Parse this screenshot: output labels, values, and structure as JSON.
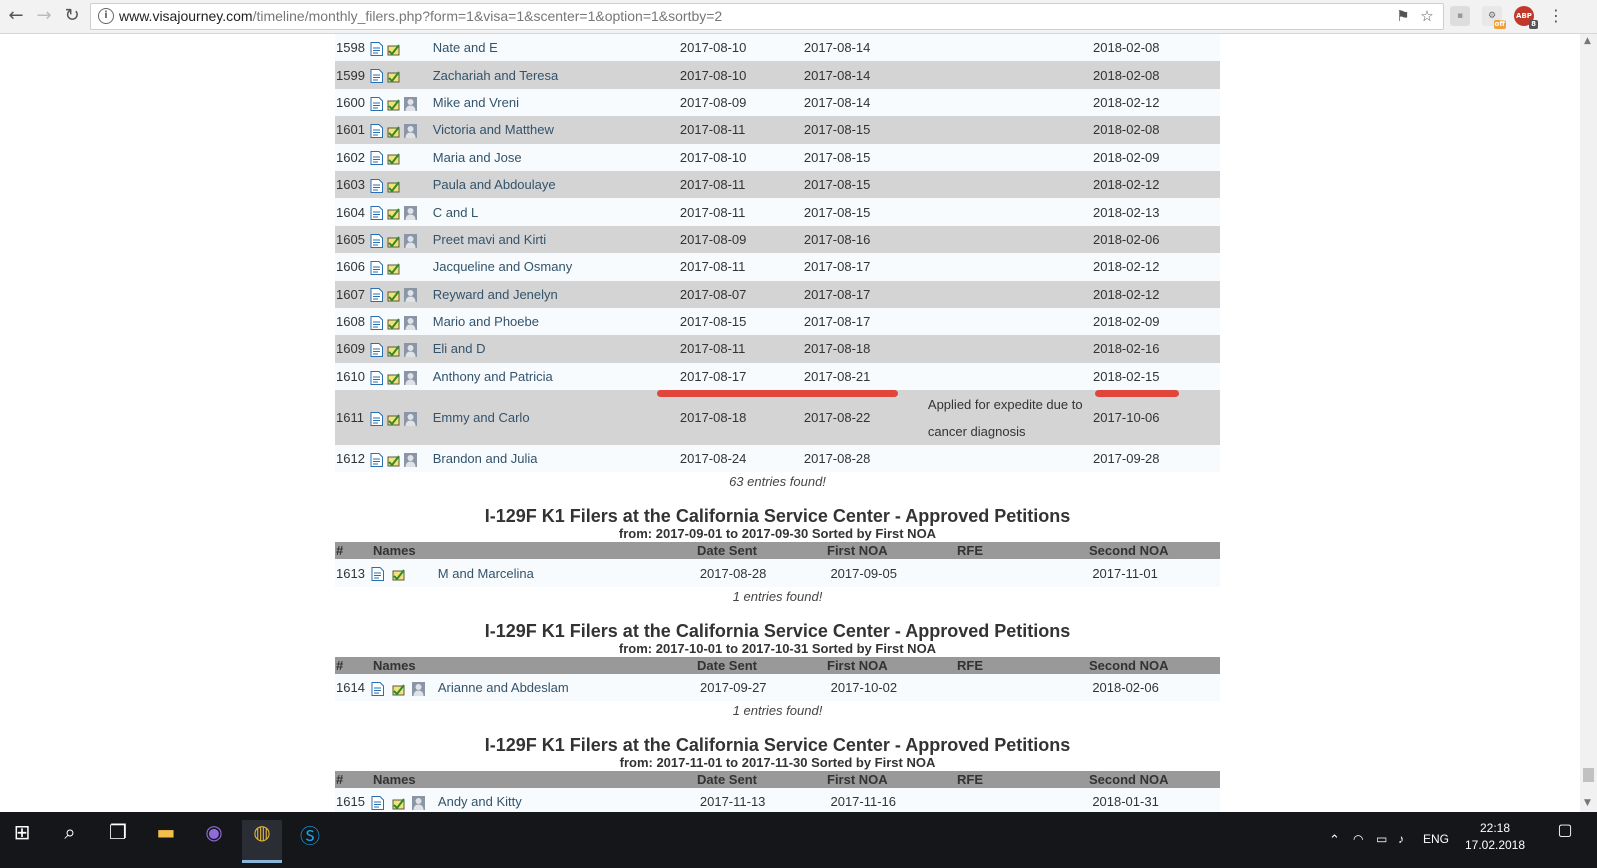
{
  "browser": {
    "url_host": "www.visajourney.com",
    "url_path": "/timeline/monthly_filers.php?form=1&visa=1&scenter=1&option=1&sortby=2",
    "ext_abp_label": "ABP",
    "ext_abp_badge": "8",
    "ext_off_label": "off"
  },
  "section1": {
    "rows": [
      {
        "num": "1598",
        "name": "Nate and E",
        "sent": "2017-08-10",
        "noa1": "2017-08-14",
        "rfe": "",
        "noa2": "2018-02-08",
        "avatar": false
      },
      {
        "num": "1599",
        "name": "Zachariah and Teresa",
        "sent": "2017-08-10",
        "noa1": "2017-08-14",
        "rfe": "",
        "noa2": "2018-02-08",
        "avatar": false
      },
      {
        "num": "1600",
        "name": "Mike and Vreni",
        "sent": "2017-08-09",
        "noa1": "2017-08-14",
        "rfe": "",
        "noa2": "2018-02-12",
        "avatar": true
      },
      {
        "num": "1601",
        "name": "Victoria and Matthew",
        "sent": "2017-08-11",
        "noa1": "2017-08-15",
        "rfe": "",
        "noa2": "2018-02-08",
        "avatar": true
      },
      {
        "num": "1602",
        "name": "Maria and Jose",
        "sent": "2017-08-10",
        "noa1": "2017-08-15",
        "rfe": "",
        "noa2": "2018-02-09",
        "avatar": false
      },
      {
        "num": "1603",
        "name": "Paula and Abdoulaye",
        "sent": "2017-08-11",
        "noa1": "2017-08-15",
        "rfe": "",
        "noa2": "2018-02-12",
        "avatar": false
      },
      {
        "num": "1604",
        "name": "C and L",
        "sent": "2017-08-11",
        "noa1": "2017-08-15",
        "rfe": "",
        "noa2": "2018-02-13",
        "avatar": true
      },
      {
        "num": "1605",
        "name": "Preet mavi and Kirti",
        "sent": "2017-08-09",
        "noa1": "2017-08-16",
        "rfe": "",
        "noa2": "2018-02-06",
        "avatar": true
      },
      {
        "num": "1606",
        "name": "Jacqueline and Osmany",
        "sent": "2017-08-11",
        "noa1": "2017-08-17",
        "rfe": "",
        "noa2": "2018-02-12",
        "avatar": false
      },
      {
        "num": "1607",
        "name": "Reyward and Jenelyn",
        "sent": "2017-08-07",
        "noa1": "2017-08-17",
        "rfe": "",
        "noa2": "2018-02-12",
        "avatar": true
      },
      {
        "num": "1608",
        "name": "Mario and Phoebe",
        "sent": "2017-08-15",
        "noa1": "2017-08-17",
        "rfe": "",
        "noa2": "2018-02-09",
        "avatar": true
      },
      {
        "num": "1609",
        "name": "Eli and D",
        "sent": "2017-08-11",
        "noa1": "2017-08-18",
        "rfe": "",
        "noa2": "2018-02-16",
        "avatar": true
      },
      {
        "num": "1610",
        "name": "Anthony and Patricia",
        "sent": "2017-08-17",
        "noa1": "2017-08-21",
        "rfe": "",
        "noa2": "2018-02-15",
        "avatar": true
      },
      {
        "num": "1611",
        "name": "Emmy and Carlo",
        "sent": "2017-08-18",
        "noa1": "2017-08-22",
        "rfe": "Applied for expedite due to cancer diagnosis",
        "noa2": "2017-10-06",
        "avatar": true
      },
      {
        "num": "1612",
        "name": "Brandon and Julia",
        "sent": "2017-08-24",
        "noa1": "2017-08-28",
        "rfe": "",
        "noa2": "2017-09-28",
        "avatar": true
      }
    ],
    "found": "63 entries found!"
  },
  "headers": {
    "num": "#",
    "names": "Names",
    "sent": "Date Sent",
    "noa1": "First NOA",
    "rfe": "RFE",
    "noa2": "Second NOA"
  },
  "section2": {
    "title": "I-129F K1 Filers at the California Service Center - Approved Petitions",
    "subtitle": "from: 2017-09-01 to 2017-09-30 Sorted by First NOA",
    "row": {
      "num": "1613",
      "name": "M and Marcelina",
      "sent": "2017-08-28",
      "noa1": "2017-09-05",
      "rfe": "",
      "noa2": "2017-11-01"
    },
    "found": "1 entries found!"
  },
  "section3": {
    "title": "I-129F K1 Filers at the California Service Center - Approved Petitions",
    "subtitle": "from: 2017-10-01 to 2017-10-31 Sorted by First NOA",
    "row": {
      "num": "1614",
      "name": "Arianne and Abdeslam",
      "sent": "2017-09-27",
      "noa1": "2017-10-02",
      "rfe": "",
      "noa2": "2018-02-06"
    },
    "found": "1 entries found!"
  },
  "section4": {
    "title": "I-129F K1 Filers at the California Service Center - Approved Petitions",
    "subtitle": "from: 2017-11-01 to 2017-11-30 Sorted by First NOA",
    "row": {
      "num": "1615",
      "name": "Andy and Kitty",
      "sent": "2017-11-13",
      "noa1": "2017-11-16",
      "rfe": "",
      "noa2": "2018-01-31"
    }
  },
  "taskbar": {
    "language": "ENG",
    "time": "22:18",
    "date": "17.02.2018"
  },
  "colors": {
    "row_light": "#f7fbfd",
    "row_dark": "#d4d4d4",
    "header_bg": "#999999",
    "link": "#33536b",
    "annotation": "#e0473a"
  }
}
